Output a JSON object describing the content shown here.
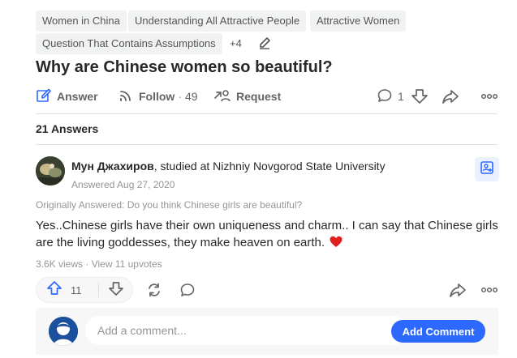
{
  "topics": [
    "Women in China",
    "Understanding All Attractive People",
    "Attractive Women",
    "Question That Contains Assumptions"
  ],
  "topics_more": "+4",
  "question": {
    "title": "Why are Chinese women so beautiful?"
  },
  "actions": {
    "answer_label": "Answer",
    "follow_label": "Follow",
    "follow_count": "49",
    "request_label": "Request",
    "comment_count": "1"
  },
  "answers_count": "21 Answers",
  "answer": {
    "author_name": "Мун Джахиров",
    "author_credential": ", studied at Nizhniy Novgorod State University",
    "answered_date": "Answered Aug 27, 2020",
    "originally_answered": "Originally Answered: Do you think Chinese girls are beautiful?",
    "text": "Yes..Chinese girls have their own uniqueness and charm.. I can say that Chinese girls are the living goddesses, they make heaven on earth.",
    "views_text": "3.6K views · View 11 upvotes",
    "upvotes": "11"
  },
  "comment_box": {
    "placeholder": "Add a comment...",
    "button_label": "Add Comment"
  },
  "colors": {
    "accent": "#2e69ff",
    "heart": "#e02020"
  },
  "icons": [
    "pencil-icon",
    "answer-edit-icon",
    "follow-icon",
    "request-icon",
    "comment-icon",
    "downvote-icon",
    "share-icon",
    "more-icon",
    "follow-author-icon",
    "heart-icon",
    "upvote-icon",
    "reshare-icon"
  ]
}
